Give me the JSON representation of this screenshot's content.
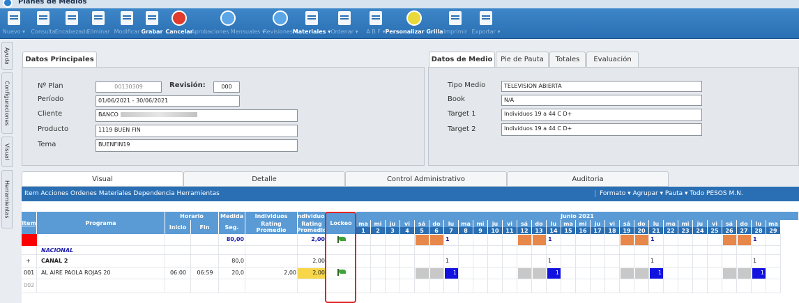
{
  "window": {
    "title": "Planes de Medios"
  },
  "toolbar": [
    {
      "label": "Nuevo",
      "icon": "new-document-icon",
      "arrow": true,
      "enabled": false
    },
    {
      "label": "Consulta",
      "icon": "search-document-icon",
      "arrow": false,
      "enabled": false
    },
    {
      "label": "Encabezado",
      "icon": "edit-document-icon",
      "arrow": false,
      "enabled": false
    },
    {
      "label": "Eliminar",
      "icon": "delete-document-icon",
      "arrow": false,
      "enabled": false
    },
    {
      "label": "Modificar",
      "icon": "modify-document-icon",
      "arrow": false,
      "enabled": false
    },
    {
      "label": "Grabar",
      "icon": "save-icon",
      "arrow": false,
      "enabled": true
    },
    {
      "label": "Cancelar",
      "icon": "cancel-icon",
      "arrow": false,
      "enabled": true
    },
    {
      "label": "Aprobaciones Mensuales",
      "icon": "approvals-icon",
      "arrow": true,
      "enabled": false
    },
    {
      "label": "Revisiones",
      "icon": "revisions-icon",
      "arrow": true,
      "enabled": false
    },
    {
      "label": "Materiales",
      "icon": "materials-icon",
      "arrow": true,
      "enabled": true
    },
    {
      "label": "Ordenar",
      "icon": "order-icon",
      "arrow": true,
      "enabled": false
    },
    {
      "label": "A B F",
      "icon": "abf-icon",
      "arrow": true,
      "enabled": false
    },
    {
      "label": "Personalizar Grilla",
      "icon": "customize-grid-icon",
      "arrow": false,
      "enabled": true
    },
    {
      "label": "Imprimir",
      "icon": "print-icon",
      "arrow": false,
      "enabled": false
    },
    {
      "label": "Exportar",
      "icon": "export-icon",
      "arrow": true,
      "enabled": false
    }
  ],
  "sidetabs": [
    "Ayuda",
    "Configuraciones",
    "Visual",
    "Herramientas"
  ],
  "datos_principales": {
    "tab": "Datos Principales",
    "plan_label": "Nº Plan",
    "plan_value": "00130309",
    "revision_label": "Revisión:",
    "revision_value": "000",
    "periodo_label": "Período",
    "periodo_value": "01/06/2021 - 30/06/2021",
    "cliente_label": "Cliente",
    "cliente_value": "BANCO",
    "producto_label": "Producto",
    "producto_value": "1119 BUEN FIN",
    "tema_label": "Tema",
    "tema_value": "BUENFIN19"
  },
  "datos_medio": {
    "tabs": [
      "Datos de Medio",
      "Pie de Pauta",
      "Totales",
      "Evaluación"
    ],
    "tipo_label": "Tipo Medio",
    "tipo_value": "TELEVISION ABIERTA",
    "book_label": "Book",
    "book_value": "N/A",
    "t1_label": "Target 1",
    "t1_value": "Individuos 19 a 44 C D+",
    "t2_label": "Target 2",
    "t2_value": "Individuos 19 a 44 C D+"
  },
  "bottom_tabs": [
    "Visual",
    "Detalle",
    "Control Administrativo",
    "Auditoria"
  ],
  "menu_left": "Item  Acciones  Ordenes  Materiales  Dependencia  Herramientas",
  "menu_right": "Formato ▾  Agrupar ▾  Pauta ▾  Todo  PESOS M.N.",
  "grid": {
    "h_item": "Item",
    "h_programa": "Programa",
    "h_horario": "Horario",
    "h_inicio": "Inicio",
    "h_fin": "Fin",
    "h_medida": "Medida",
    "h_seg": "Seg.",
    "h_ind1": "Individuos",
    "h_rating1": "Rating Promedio",
    "h_ind2": "Individuos",
    "h_rating2": "Rating Promedio",
    "h_lockeo": "Lockeo",
    "month": "Junio 2021",
    "weekdays": [
      "ma",
      "mi",
      "ju",
      "vi",
      "sá",
      "do",
      "lu",
      "ma",
      "mi",
      "ju",
      "vi",
      "sá",
      "do",
      "lu",
      "ma",
      "mi",
      "ju",
      "vi",
      "sá",
      "do",
      "lu",
      "ma",
      "mi",
      "ju",
      "vi",
      "sá",
      "do",
      "lu",
      "ma"
    ],
    "days": [
      "1",
      "2",
      "3",
      "4",
      "5",
      "6",
      "7",
      "8",
      "9",
      "10",
      "11",
      "12",
      "13",
      "14",
      "15",
      "16",
      "17",
      "18",
      "19",
      "20",
      "21",
      "22",
      "23",
      "24",
      "25",
      "26",
      "27",
      "28",
      "29"
    ],
    "row1": {
      "seg": "80,00",
      "rating2": "2,00",
      "marks": [
        "1",
        "1",
        "1",
        "1"
      ]
    },
    "row2": {
      "programa": "NACIONAL"
    },
    "row3": {
      "item": "+",
      "programa": "CANAL 2",
      "seg": "80,0",
      "rating2": "2,00",
      "marks": [
        "1",
        "1",
        "1",
        "1"
      ]
    },
    "row4": {
      "item": "001",
      "programa": "AL AIRE PAOLA ROJAS 20",
      "inicio": "06:00",
      "fin": "06:59",
      "seg": "20,0",
      "rating1": "2,00",
      "rating2": "2,00",
      "marks": [
        "1",
        "1",
        "1",
        "1"
      ]
    },
    "row5": {
      "item": "002"
    },
    "colors": {
      "weekend": "#e8874a",
      "gray": "#c8c8c8",
      "blue": "#1212e0",
      "red": "#ff0000",
      "yellow": "#f7d64a",
      "header": "#5b9bd5",
      "header_dark": "#2a6fb3"
    }
  }
}
